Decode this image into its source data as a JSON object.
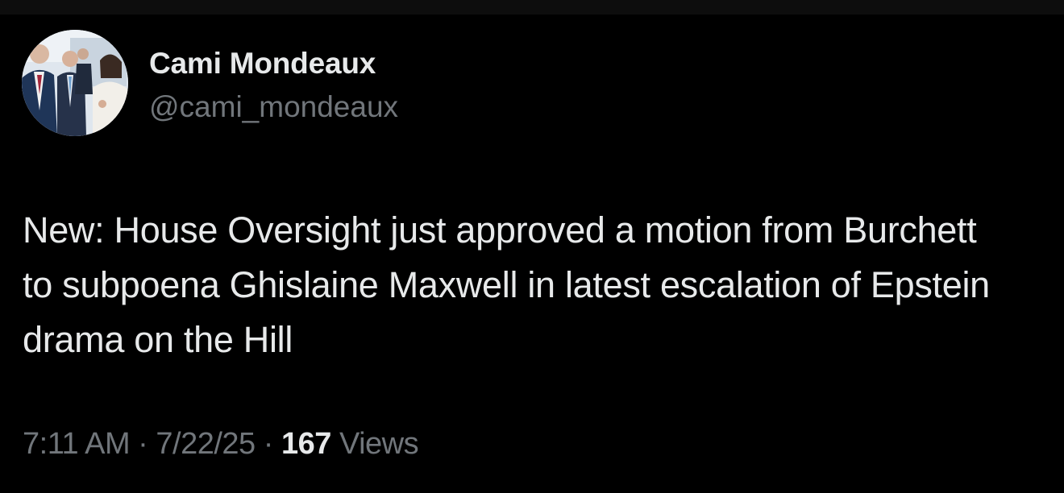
{
  "author": {
    "display_name": "Cami Mondeaux",
    "handle": "@cami_mondeaux"
  },
  "tweet": {
    "text": "New: House Oversight just approved a motion from Burchett to subpoena Ghislaine Maxwell in latest escalation of Epstein drama on the Hill"
  },
  "meta": {
    "time": "7:11 AM",
    "separator": "·",
    "date": "7/22/25",
    "views_count": "167",
    "views_label": "Views"
  },
  "colors": {
    "background": "#000000",
    "primary_text": "#e7e9ea",
    "secondary_text": "#71767b"
  }
}
